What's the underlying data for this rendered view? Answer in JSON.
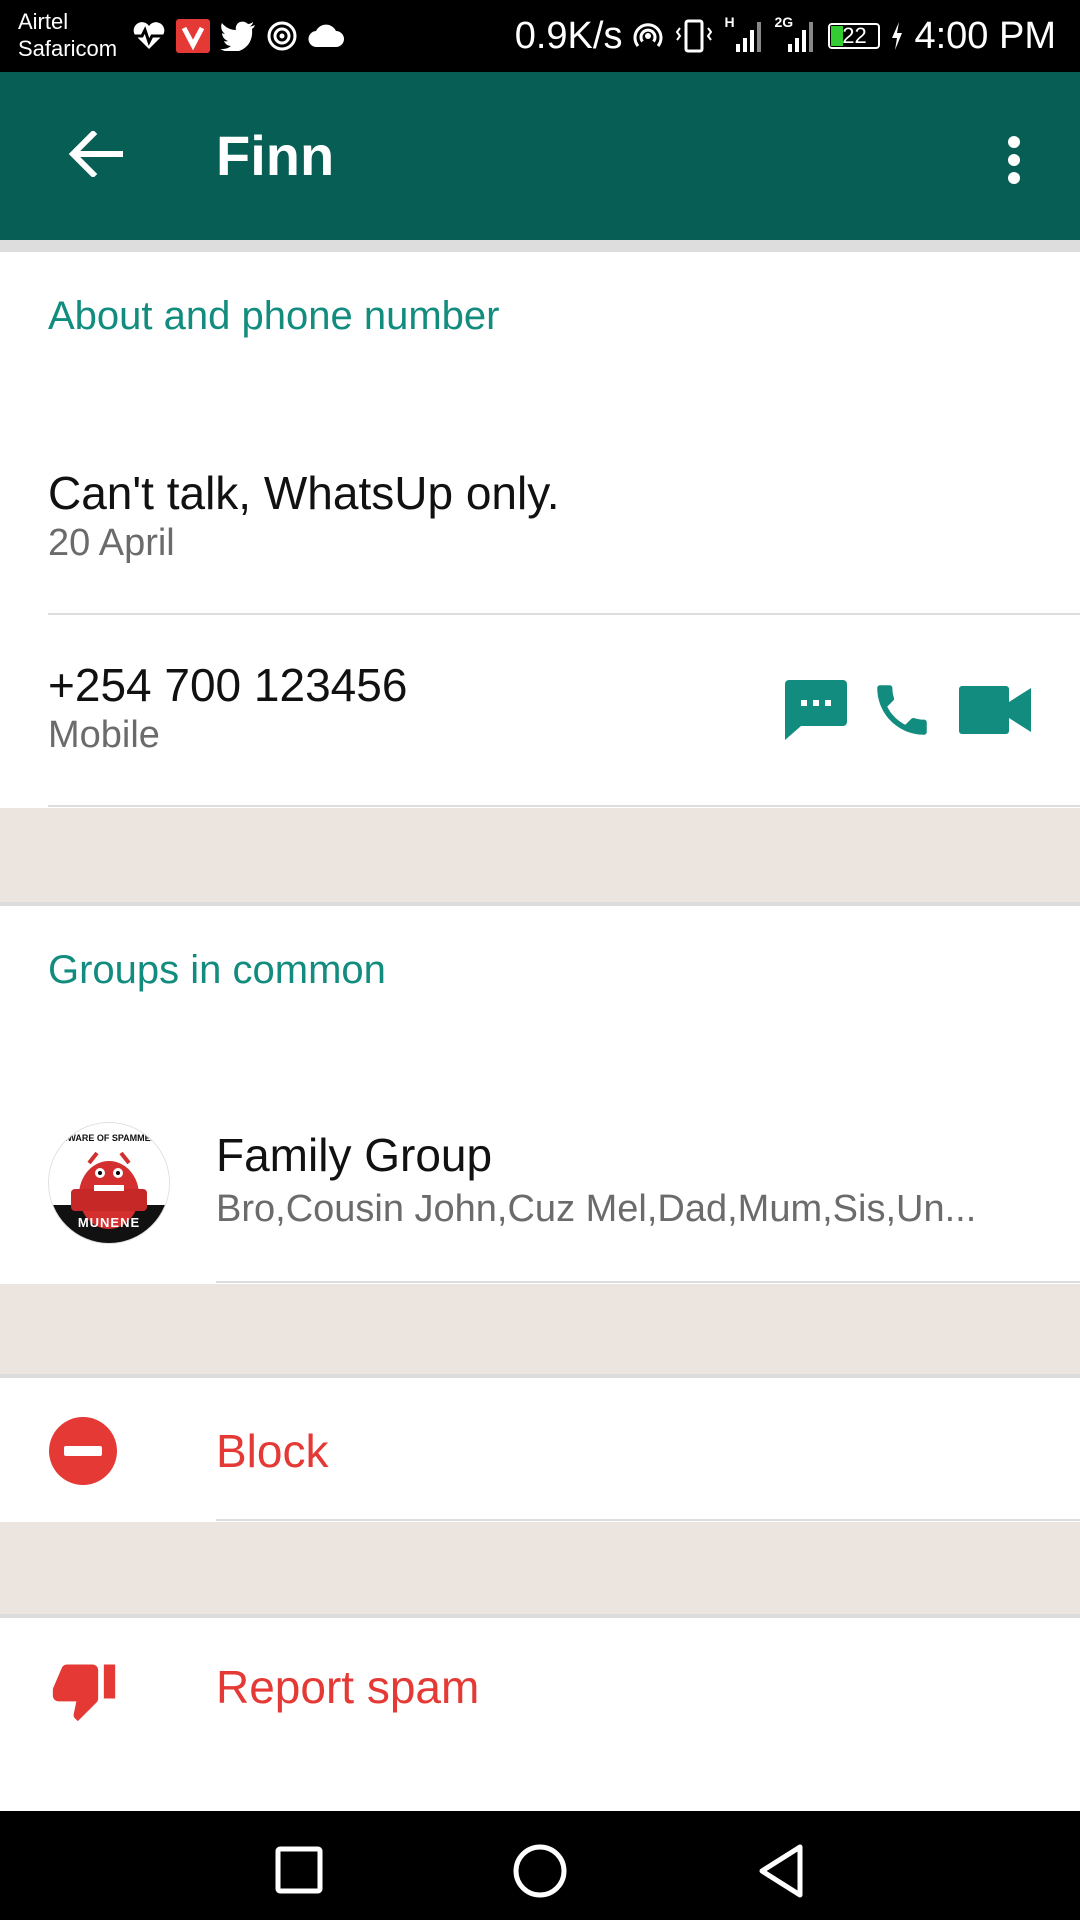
{
  "status_bar": {
    "carrier_line1": "Airtel",
    "carrier_line2": "Safaricom",
    "net_speed": "0.9K/s",
    "signal1_label": "H",
    "signal2_label": "2G",
    "battery": "22",
    "time": "4:00 PM"
  },
  "app_bar": {
    "title": "Finn"
  },
  "about": {
    "header": "About and phone number",
    "status_text": "Can't talk, WhatsUp only.",
    "status_date": "20 April",
    "phone": "+254 700 123456",
    "phone_type": "Mobile"
  },
  "groups": {
    "header": "Groups in common",
    "items": [
      {
        "name": "Family Group",
        "members": "Bro,Cousin John,Cuz Mel,Dad,Mum,Sis,Un...",
        "avatar_top_text": "BEWARE OF SPAMMERS",
        "avatar_bottom_text": "MUNENE"
      }
    ]
  },
  "actions": {
    "block_label": "Block",
    "report_label": "Report spam"
  },
  "colors": {
    "app_bar": "#075e54",
    "accent": "#128c7e",
    "danger": "#e53935",
    "band": "#ece5df"
  },
  "icons": {
    "back": "arrow-left-icon",
    "more": "more-vert-icon",
    "message": "message-icon",
    "call": "phone-icon",
    "video": "video-icon",
    "block": "block-icon",
    "report": "thumb-down-icon"
  }
}
